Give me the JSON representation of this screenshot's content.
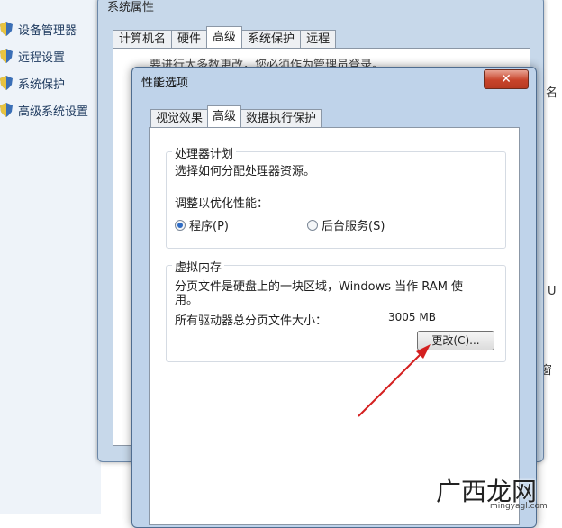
{
  "sidebar": {
    "items": [
      {
        "label": "设备管理器",
        "icon": "shield-icon"
      },
      {
        "label": "远程设置",
        "icon": "shield-icon"
      },
      {
        "label": "系统保护",
        "icon": "shield-icon"
      },
      {
        "label": "高级系统设置",
        "icon": "shield-icon"
      }
    ]
  },
  "back_window": {
    "title": "系统属性",
    "tabs": [
      "计算机名",
      "硬件",
      "高级",
      "系统保护",
      "远程"
    ],
    "active_tab": "高级",
    "hint": "要进行大多数更改，您必须作为管理员登录。"
  },
  "right_fragments": [
    "名",
    "U",
    "窗"
  ],
  "dialog": {
    "title": "性能选项",
    "close_icon": "close-icon",
    "tabs": [
      "视觉效果",
      "高级",
      "数据执行保护"
    ],
    "active_tab": "高级",
    "processor": {
      "group_title": "处理器计划",
      "description": "选择如何分配处理器资源。",
      "adjust_label": "调整以优化性能：",
      "options": [
        {
          "label": "程序(P)",
          "selected": true
        },
        {
          "label": "后台服务(S)",
          "selected": false
        }
      ]
    },
    "memory": {
      "group_title": "虚拟内存",
      "description_line1": "分页文件是硬盘上的一块区域，Windows 当作 RAM 使",
      "description_line2": "用。",
      "total_label": "所有驱动器总分页文件大小：",
      "total_value": "3005 MB",
      "change_button": "更改(C)..."
    }
  },
  "watermark": {
    "text": "广西龙网",
    "url": "mingyagl.com"
  },
  "colors": {
    "arrow": "#d42020",
    "close_button": "#c8442b"
  }
}
